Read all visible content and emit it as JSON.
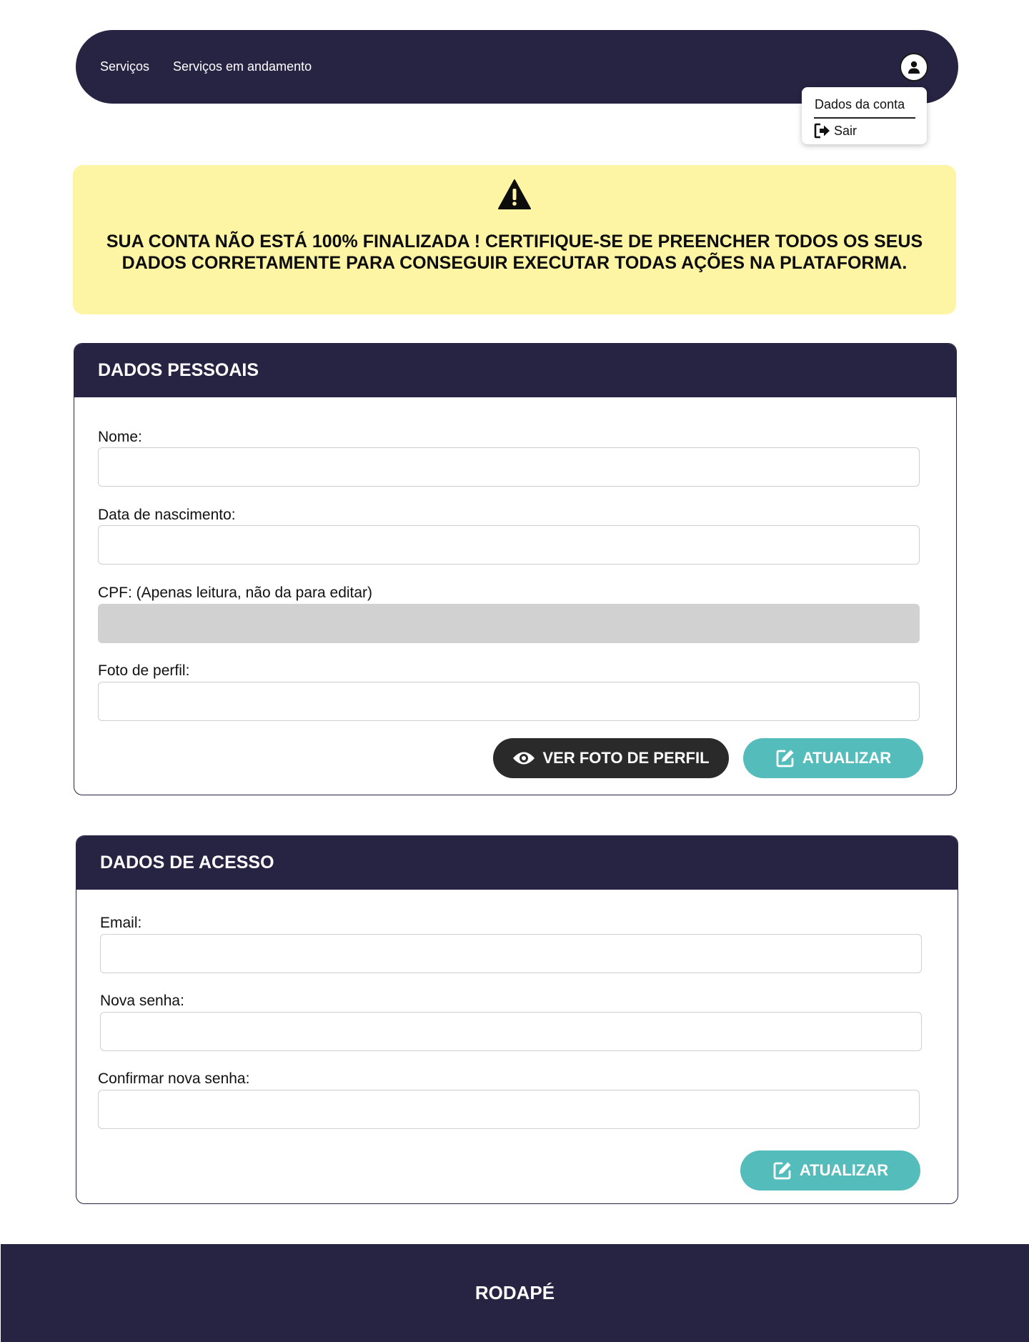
{
  "navbar": {
    "links": [
      "Serviços",
      "Serviços em andamento"
    ],
    "avatar_icon": "user-icon"
  },
  "account_menu": {
    "account_label": "Dados da conta",
    "logout_label": "Sair",
    "logout_icon": "logout-icon"
  },
  "alert": {
    "icon": "warning-icon",
    "message": "SUA CONTA NÃO ESTÁ 100% FINALIZADA ! CERTIFIQUE-SE DE PREENCHER TODOS OS SEUS DADOS CORRETAMENTE PARA CONSEGUIR EXECUTAR TODAS AÇÕES NA PLATAFORMA.",
    "background": "#fef5a4"
  },
  "personal_data": {
    "title": "DADOS PESSOAIS",
    "fields": [
      {
        "label": "Nome:",
        "value": ""
      },
      {
        "label": "Data de nascimento:",
        "value": ""
      },
      {
        "label": "CPF: (Apenas leitura, não da para editar)",
        "value": "",
        "readonly": true
      },
      {
        "label": "Foto de perfil:",
        "value": ""
      }
    ],
    "view_photo_button": "VER FOTO DE PERFIL",
    "view_photo_icon": "eye-icon",
    "update_button": "ATUALIZAR",
    "update_icon": "edit-icon"
  },
  "access_data": {
    "title": "DADOS DE ACESSO",
    "fields": [
      {
        "label": "Email:",
        "value": ""
      },
      {
        "label": "Nova senha:",
        "value": ""
      },
      {
        "label": "Confirmar nova senha:",
        "value": ""
      }
    ],
    "update_button": "ATUALIZAR",
    "update_icon": "edit-icon"
  },
  "footer": {
    "text": "RODAPÉ"
  },
  "colors": {
    "primary": "#262343",
    "teal": "#55bcbc",
    "dark_button": "#2a2a2a",
    "readonly_input": "#d1d1d1"
  }
}
